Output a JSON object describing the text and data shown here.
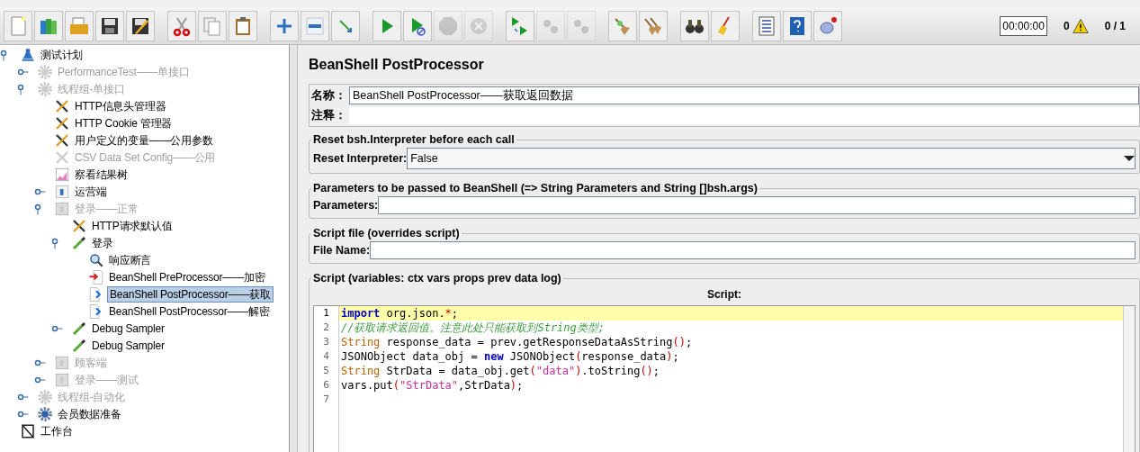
{
  "toolbar": [
    {
      "kind": "new",
      "disabled": false
    },
    {
      "kind": "templates",
      "disabled": false
    },
    {
      "kind": "open",
      "disabled": false
    },
    {
      "kind": "save",
      "disabled": false
    },
    {
      "kind": "save-as",
      "disabled": false
    },
    {
      "kind": "cut",
      "disabled": false
    },
    {
      "kind": "copy",
      "disabled": false
    },
    {
      "kind": "paste",
      "disabled": false
    },
    {
      "kind": "expand",
      "disabled": false
    },
    {
      "kind": "collapse",
      "disabled": false
    },
    {
      "kind": "toggle",
      "disabled": false
    },
    {
      "kind": "start",
      "disabled": false
    },
    {
      "kind": "start-no-pause",
      "disabled": false
    },
    {
      "kind": "stop",
      "disabled": true
    },
    {
      "kind": "shutdown",
      "disabled": true
    },
    {
      "kind": "remote-start",
      "disabled": false
    },
    {
      "kind": "remote-stop",
      "disabled": true
    },
    {
      "kind": "remote-exit",
      "disabled": true
    },
    {
      "kind": "clear",
      "disabled": false
    },
    {
      "kind": "clear-all",
      "disabled": false
    },
    {
      "kind": "search",
      "disabled": false
    },
    {
      "kind": "reset-search",
      "disabled": false
    },
    {
      "kind": "function-helper",
      "disabled": false
    },
    {
      "kind": "help",
      "disabled": false
    },
    {
      "kind": "logger",
      "disabled": false
    }
  ],
  "status": {
    "timer": "00:00:00",
    "warnings": "0",
    "threads": "0 / 1"
  },
  "tree": [
    {
      "label": "测试计划",
      "kind": "plan",
      "disabled": false,
      "selected": false,
      "expanded": true,
      "children": [
        {
          "label": "PerformanceTest——单接口",
          "kind": "threadgroup",
          "disabled": true,
          "selected": false,
          "expanded": false
        },
        {
          "label": "线程组-单接口",
          "kind": "threadgroup",
          "disabled": true,
          "selected": false,
          "expanded": true,
          "children": [
            {
              "label": "HTTP信息头管理器",
              "kind": "config",
              "disabled": false,
              "selected": false
            },
            {
              "label": "HTTP Cookie 管理器",
              "kind": "config",
              "disabled": false,
              "selected": false
            },
            {
              "label": "用户定义的变量——公用参数",
              "kind": "config",
              "disabled": false,
              "selected": false
            },
            {
              "label": "CSV Data Set Config——公用",
              "kind": "config",
              "disabled": true,
              "selected": false
            },
            {
              "label": "察看结果树",
              "kind": "listener",
              "disabled": false,
              "selected": false
            },
            {
              "label": "运营端",
              "kind": "controller",
              "disabled": false,
              "selected": false,
              "expanded": false
            },
            {
              "label": "登录——正常",
              "kind": "controller",
              "disabled": true,
              "selected": false,
              "expanded": true,
              "children": [
                {
                  "label": "HTTP请求默认值",
                  "kind": "config",
                  "disabled": false,
                  "selected": false
                },
                {
                  "label": "登录",
                  "kind": "sampler",
                  "disabled": false,
                  "selected": false,
                  "expanded": true,
                  "children": [
                    {
                      "label": "响应断言",
                      "kind": "assertion",
                      "disabled": false,
                      "selected": false
                    },
                    {
                      "label": "BeanShell PreProcessor——加密",
                      "kind": "preprocessor",
                      "disabled": false,
                      "selected": false
                    },
                    {
                      "label": "BeanShell PostProcessor——获取",
                      "kind": "postprocessor",
                      "disabled": false,
                      "selected": true
                    },
                    {
                      "label": "BeanShell PostProcessor——解密",
                      "kind": "postprocessor",
                      "disabled": false,
                      "selected": false
                    }
                  ]
                },
                {
                  "label": "Debug Sampler",
                  "kind": "sampler",
                  "disabled": false,
                  "selected": false,
                  "expanded": false
                },
                {
                  "label": "Debug Sampler",
                  "kind": "sampler",
                  "disabled": false,
                  "selected": false
                }
              ]
            },
            {
              "label": "顾客端",
              "kind": "controller",
              "disabled": true,
              "selected": false,
              "expanded": false
            },
            {
              "label": "登录——测试",
              "kind": "controller",
              "disabled": true,
              "selected": false,
              "expanded": false
            }
          ]
        },
        {
          "label": "线程组-自动化",
          "kind": "threadgroup",
          "disabled": true,
          "selected": false,
          "expanded": false
        },
        {
          "label": "会员数据准备",
          "kind": "threadgroup",
          "disabled": false,
          "selected": false,
          "expanded": false
        }
      ]
    },
    {
      "label": "工作台",
      "kind": "workbench",
      "disabled": false,
      "selected": false
    }
  ],
  "panel": {
    "title": "BeanShell PostProcessor",
    "name_label": "名称：",
    "name_value": "BeanShell PostProcessor——获取返回数据",
    "comment_label": "注释：",
    "reset_group": "Reset bsh.Interpreter before each call",
    "reset_label": "Reset Interpreter:",
    "reset_value": "False",
    "params_group": "Parameters to be passed to BeanShell (=> String Parameters and String []bsh.args)",
    "params_label": "Parameters:",
    "file_group": "Script file (overrides script)",
    "file_label": "File Name:",
    "script_group": "Script (variables: ctx vars props prev data log)",
    "script_heading": "Script:",
    "lines": [
      {
        "number": "1",
        "current": true,
        "tokens": [
          {
            "kind": "keyword",
            "text": "import"
          },
          {
            "kind": "plain",
            "text": " org.json."
          },
          {
            "kind": "operator",
            "text": "*"
          },
          {
            "kind": "plain",
            "text": ";"
          }
        ]
      },
      {
        "number": "2",
        "current": false,
        "tokens": [
          {
            "kind": "comment",
            "text": "//获取请求返回值。注意此处只能获取到String类型;"
          }
        ]
      },
      {
        "number": "3",
        "current": false,
        "tokens": [
          {
            "kind": "type",
            "text": "String"
          },
          {
            "kind": "plain",
            "text": " response_data = prev.getResponseDataAsString"
          },
          {
            "kind": "operator",
            "text": "()"
          },
          {
            "kind": "plain",
            "text": ";"
          }
        ]
      },
      {
        "number": "4",
        "current": false,
        "tokens": [
          {
            "kind": "plain",
            "text": "JSONObject data_obj = "
          },
          {
            "kind": "keyword",
            "text": "new"
          },
          {
            "kind": "plain",
            "text": " JSONObject"
          },
          {
            "kind": "operator",
            "text": "("
          },
          {
            "kind": "plain",
            "text": "response_data"
          },
          {
            "kind": "operator",
            "text": ")"
          },
          {
            "kind": "plain",
            "text": ";"
          }
        ]
      },
      {
        "number": "5",
        "current": false,
        "tokens": [
          {
            "kind": "type",
            "text": "String"
          },
          {
            "kind": "plain",
            "text": " StrData = data_obj.get"
          },
          {
            "kind": "operator",
            "text": "("
          },
          {
            "kind": "string",
            "text": "\"data\""
          },
          {
            "kind": "operator",
            "text": ")"
          },
          {
            "kind": "plain",
            "text": ".toString"
          },
          {
            "kind": "operator",
            "text": "()"
          },
          {
            "kind": "plain",
            "text": ";"
          }
        ]
      },
      {
        "number": "6",
        "current": false,
        "tokens": [
          {
            "kind": "plain",
            "text": "vars.put"
          },
          {
            "kind": "operator",
            "text": "("
          },
          {
            "kind": "string",
            "text": "\"StrData\""
          },
          {
            "kind": "plain",
            "text": ",StrData"
          },
          {
            "kind": "operator",
            "text": ")"
          },
          {
            "kind": "plain",
            "text": ";"
          }
        ]
      },
      {
        "number": "7",
        "current": false
      }
    ]
  }
}
